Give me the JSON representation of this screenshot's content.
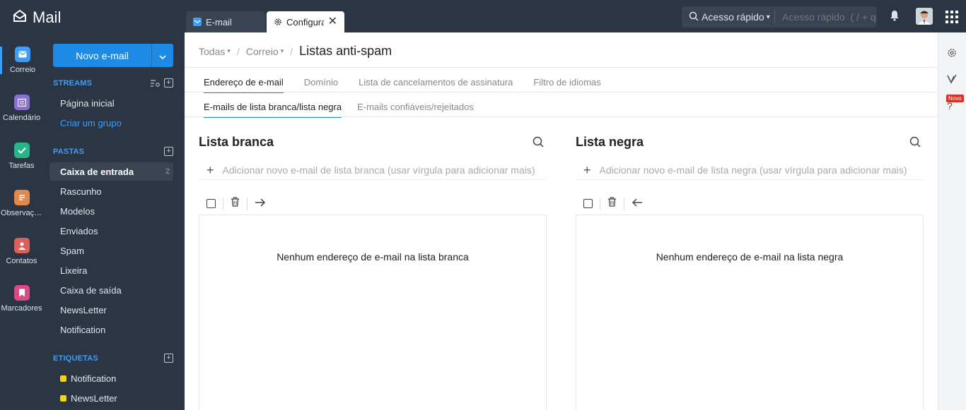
{
  "app": {
    "title": "Mail"
  },
  "window_tabs": [
    {
      "label": "E-mail"
    },
    {
      "label": "Configurações"
    }
  ],
  "quick_access": {
    "label": "Acesso rápido",
    "placeholder": "Acesso rápido  ( / + q )"
  },
  "rail": [
    {
      "label": "Correio",
      "icon": "mail-icon",
      "color": "#3f9ef3"
    },
    {
      "label": "Calendário",
      "icon": "calendar-icon",
      "color": "#8b6fd6"
    },
    {
      "label": "Tarefas",
      "icon": "tasks-check-icon",
      "color": "#27b58a"
    },
    {
      "label": "Observações",
      "icon": "notes-icon",
      "color": "#e0894a"
    },
    {
      "label": "Contatos",
      "icon": "contacts-icon",
      "color": "#d9615b"
    },
    {
      "label": "Marcadores",
      "icon": "bookmark-icon",
      "color": "#d94b84"
    }
  ],
  "sidebar": {
    "new_mail": "Novo e-mail",
    "streams_header": "STREAMS",
    "streams": [
      "Página inicial",
      "Criar um grupo"
    ],
    "folders_header": "PASTAS",
    "folders": [
      {
        "label": "Caixa de entrada",
        "count": "2"
      },
      {
        "label": "Rascunho"
      },
      {
        "label": "Modelos"
      },
      {
        "label": "Enviados"
      },
      {
        "label": "Spam"
      },
      {
        "label": "Lixeira"
      },
      {
        "label": "Caixa de saída"
      },
      {
        "label": "NewsLetter"
      },
      {
        "label": "Notification"
      }
    ],
    "tags_header": "ETIQUETAS",
    "tags": [
      {
        "label": "Notification",
        "color": "#f5d40c"
      },
      {
        "label": "NewsLetter",
        "color": "#f5d40c"
      }
    ]
  },
  "breadcrumb": {
    "all": "Todas",
    "mail": "Correio",
    "title": "Listas anti-spam"
  },
  "tabs_primary": [
    "Endereço de e-mail",
    "Domínio",
    "Lista de cancelamentos de assinatura",
    "Filtro de idiomas"
  ],
  "tabs_secondary": [
    "E-mails de lista branca/lista negra",
    "E-mails confiáveis/rejeitados"
  ],
  "whitelist": {
    "title": "Lista branca",
    "add_placeholder": "Adicionar novo e-mail de lista branca (usar vírgula para adicionar mais)",
    "empty": "Nenhum endereço de e-mail na lista branca"
  },
  "blacklist": {
    "title": "Lista negra",
    "add_placeholder": "Adicionar novo e-mail de lista negra (usar vírgula para adicionar mais)",
    "empty": "Nenhum endereço de e-mail na lista negra"
  },
  "right_rail": {
    "badge": "Novo"
  }
}
